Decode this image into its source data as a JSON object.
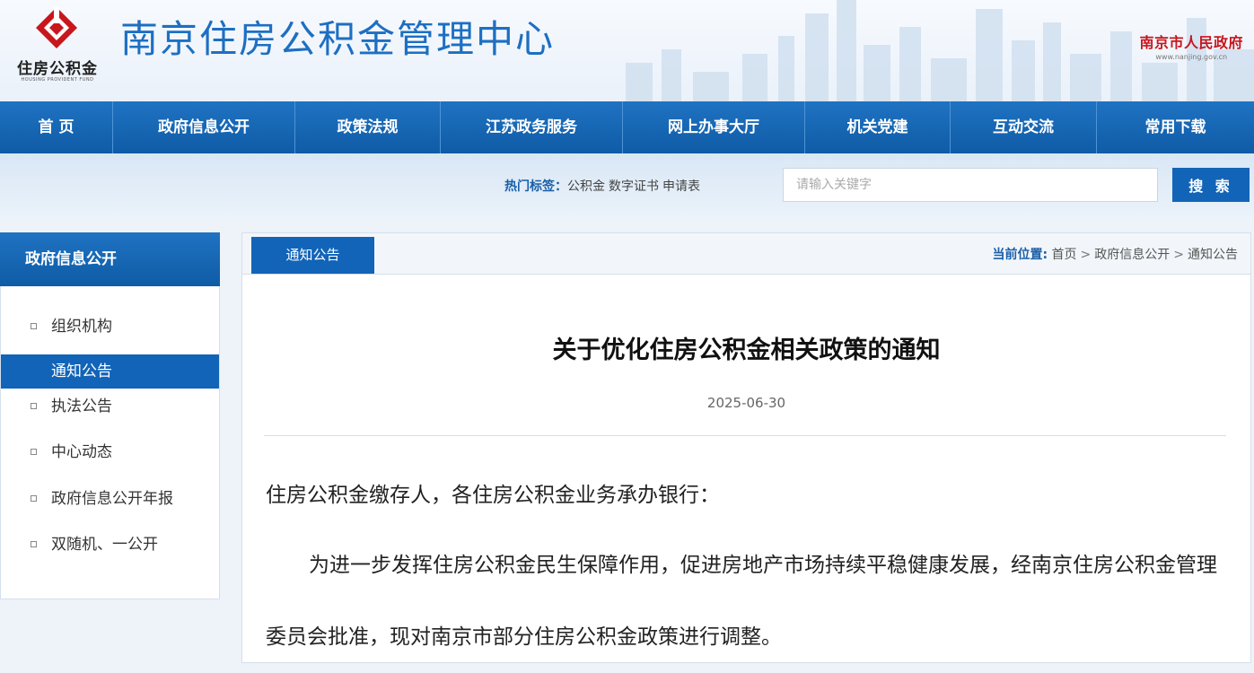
{
  "header": {
    "logo_text": "住房公积金",
    "logo_sub": "HOUSING PROVIDENT FUND",
    "site_title": "南京住房公积金管理中心",
    "gov_name": "南京市人民政府",
    "gov_url": "www.nanjing.gov.cn"
  },
  "nav": {
    "items": [
      "首 页",
      "政府信息公开",
      "政策法规",
      "江苏政务服务",
      "网上办事大厅",
      "机关党建",
      "互动交流",
      "常用下载"
    ]
  },
  "search": {
    "hot_label": "热门标签：",
    "hot_tags": [
      "公积金",
      "数字证书",
      "申请表"
    ],
    "placeholder": "请输入关键字",
    "button_label": "搜 索"
  },
  "sidebar": {
    "title": "政府信息公开",
    "items": [
      {
        "label": "组织机构",
        "active": false
      },
      {
        "label": "通知公告",
        "active": true
      },
      {
        "label": "执法公告",
        "active": false
      },
      {
        "label": "中心动态",
        "active": false
      },
      {
        "label": "政府信息公开年报",
        "active": false
      },
      {
        "label": "双随机、一公开",
        "active": false
      }
    ]
  },
  "main": {
    "tab_label": "通知公告",
    "breadcrumb": {
      "label": "当前位置:",
      "items": [
        "首页",
        "政府信息公开",
        "通知公告"
      ],
      "separator": ">"
    },
    "article": {
      "title": "关于优化住房公积金相关政策的通知",
      "date": "2025-06-30",
      "paragraphs": [
        "住房公积金缴存人，各住房公积金业务承办银行：",
        "为进一步发挥住房公积金民生保障作用，促进房地产市场持续平稳健康发展，经南京住房公积金管理委员会批准，现对南京市部分住房公积金政策进行调整。"
      ]
    }
  },
  "colors": {
    "brand_blue": "#1264b8",
    "title_blue": "#1d6fc2",
    "gov_red": "#c8161d",
    "logo_red": "#c8161d"
  }
}
